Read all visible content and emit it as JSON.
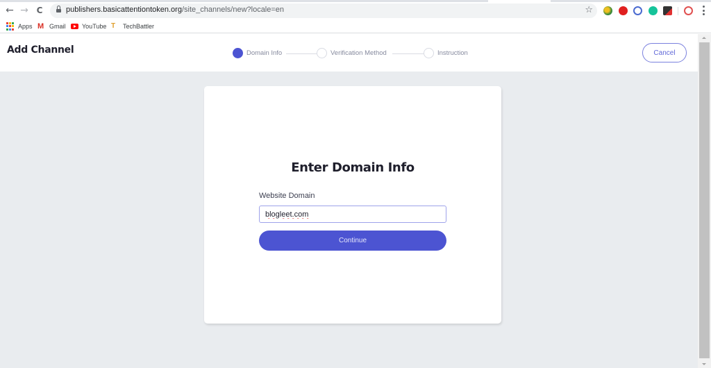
{
  "browser": {
    "url_host": "publishers.basicattentiontoken.org",
    "url_path": "/site_channels/new?locale=en",
    "nav": {
      "back_icon": "arrow-left-icon",
      "forward_icon": "arrow-right-icon",
      "reload_icon": "reload-icon",
      "back_glyph": "←",
      "forward_glyph": "→",
      "reload_glyph": "C",
      "star_glyph": "☆"
    },
    "extensions": [
      {
        "name": "extension-globe-icon",
        "color": "#3c8a3c"
      },
      {
        "name": "extension-adblock-icon",
        "color": "#e0201f"
      },
      {
        "name": "extension-block-icon",
        "color": "#4a6ad0"
      },
      {
        "name": "extension-grammarly-icon",
        "color": "#15c39a"
      },
      {
        "name": "extension-checklist-icon",
        "color": "#333333"
      },
      {
        "name": "profile-avatar-icon",
        "color": "#e05050"
      }
    ],
    "bookmarks": [
      {
        "label": "Apps",
        "icon": "apps-grid-icon"
      },
      {
        "label": "Gmail",
        "icon": "gmail-icon",
        "glyph": "M"
      },
      {
        "label": "YouTube",
        "icon": "youtube-icon"
      },
      {
        "label": "TechBattler",
        "icon": "techbattler-icon",
        "glyph": "T"
      }
    ]
  },
  "header": {
    "title": "Add Channel",
    "steps": [
      {
        "label": "Domain Info",
        "active": true
      },
      {
        "label": "Verification Method",
        "active": false
      },
      {
        "label": "Instruction",
        "active": false
      }
    ],
    "cancel_label": "Cancel"
  },
  "card": {
    "title": "Enter Domain Info",
    "field_label": "Website Domain",
    "domain_value": "blogleet.com",
    "continue_label": "Continue"
  },
  "colors": {
    "accent": "#4c54d2",
    "page_background": "#e9ecef"
  }
}
